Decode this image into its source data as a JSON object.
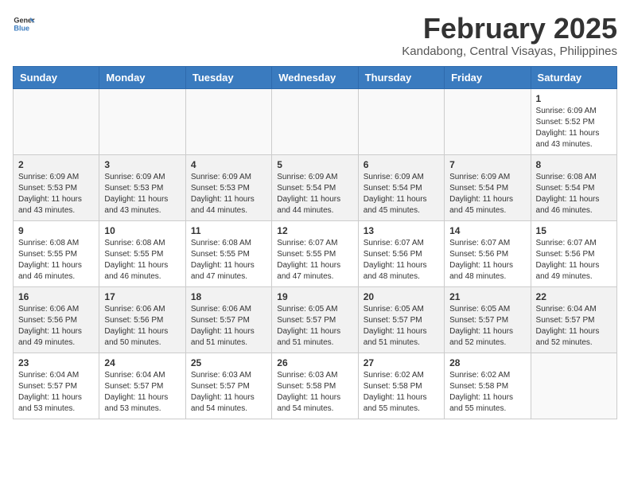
{
  "header": {
    "logo_general": "General",
    "logo_blue": "Blue",
    "month_year": "February 2025",
    "location": "Kandabong, Central Visayas, Philippines"
  },
  "days_of_week": [
    "Sunday",
    "Monday",
    "Tuesday",
    "Wednesday",
    "Thursday",
    "Friday",
    "Saturday"
  ],
  "weeks": [
    [
      {
        "day": "",
        "info": ""
      },
      {
        "day": "",
        "info": ""
      },
      {
        "day": "",
        "info": ""
      },
      {
        "day": "",
        "info": ""
      },
      {
        "day": "",
        "info": ""
      },
      {
        "day": "",
        "info": ""
      },
      {
        "day": "1",
        "info": "Sunrise: 6:09 AM\nSunset: 5:52 PM\nDaylight: 11 hours\nand 43 minutes."
      }
    ],
    [
      {
        "day": "2",
        "info": "Sunrise: 6:09 AM\nSunset: 5:53 PM\nDaylight: 11 hours\nand 43 minutes."
      },
      {
        "day": "3",
        "info": "Sunrise: 6:09 AM\nSunset: 5:53 PM\nDaylight: 11 hours\nand 43 minutes."
      },
      {
        "day": "4",
        "info": "Sunrise: 6:09 AM\nSunset: 5:53 PM\nDaylight: 11 hours\nand 44 minutes."
      },
      {
        "day": "5",
        "info": "Sunrise: 6:09 AM\nSunset: 5:54 PM\nDaylight: 11 hours\nand 44 minutes."
      },
      {
        "day": "6",
        "info": "Sunrise: 6:09 AM\nSunset: 5:54 PM\nDaylight: 11 hours\nand 45 minutes."
      },
      {
        "day": "7",
        "info": "Sunrise: 6:09 AM\nSunset: 5:54 PM\nDaylight: 11 hours\nand 45 minutes."
      },
      {
        "day": "8",
        "info": "Sunrise: 6:08 AM\nSunset: 5:54 PM\nDaylight: 11 hours\nand 46 minutes."
      }
    ],
    [
      {
        "day": "9",
        "info": "Sunrise: 6:08 AM\nSunset: 5:55 PM\nDaylight: 11 hours\nand 46 minutes."
      },
      {
        "day": "10",
        "info": "Sunrise: 6:08 AM\nSunset: 5:55 PM\nDaylight: 11 hours\nand 46 minutes."
      },
      {
        "day": "11",
        "info": "Sunrise: 6:08 AM\nSunset: 5:55 PM\nDaylight: 11 hours\nand 47 minutes."
      },
      {
        "day": "12",
        "info": "Sunrise: 6:07 AM\nSunset: 5:55 PM\nDaylight: 11 hours\nand 47 minutes."
      },
      {
        "day": "13",
        "info": "Sunrise: 6:07 AM\nSunset: 5:56 PM\nDaylight: 11 hours\nand 48 minutes."
      },
      {
        "day": "14",
        "info": "Sunrise: 6:07 AM\nSunset: 5:56 PM\nDaylight: 11 hours\nand 48 minutes."
      },
      {
        "day": "15",
        "info": "Sunrise: 6:07 AM\nSunset: 5:56 PM\nDaylight: 11 hours\nand 49 minutes."
      }
    ],
    [
      {
        "day": "16",
        "info": "Sunrise: 6:06 AM\nSunset: 5:56 PM\nDaylight: 11 hours\nand 49 minutes."
      },
      {
        "day": "17",
        "info": "Sunrise: 6:06 AM\nSunset: 5:56 PM\nDaylight: 11 hours\nand 50 minutes."
      },
      {
        "day": "18",
        "info": "Sunrise: 6:06 AM\nSunset: 5:57 PM\nDaylight: 11 hours\nand 51 minutes."
      },
      {
        "day": "19",
        "info": "Sunrise: 6:05 AM\nSunset: 5:57 PM\nDaylight: 11 hours\nand 51 minutes."
      },
      {
        "day": "20",
        "info": "Sunrise: 6:05 AM\nSunset: 5:57 PM\nDaylight: 11 hours\nand 51 minutes."
      },
      {
        "day": "21",
        "info": "Sunrise: 6:05 AM\nSunset: 5:57 PM\nDaylight: 11 hours\nand 52 minutes."
      },
      {
        "day": "22",
        "info": "Sunrise: 6:04 AM\nSunset: 5:57 PM\nDaylight: 11 hours\nand 52 minutes."
      }
    ],
    [
      {
        "day": "23",
        "info": "Sunrise: 6:04 AM\nSunset: 5:57 PM\nDaylight: 11 hours\nand 53 minutes."
      },
      {
        "day": "24",
        "info": "Sunrise: 6:04 AM\nSunset: 5:57 PM\nDaylight: 11 hours\nand 53 minutes."
      },
      {
        "day": "25",
        "info": "Sunrise: 6:03 AM\nSunset: 5:57 PM\nDaylight: 11 hours\nand 54 minutes."
      },
      {
        "day": "26",
        "info": "Sunrise: 6:03 AM\nSunset: 5:58 PM\nDaylight: 11 hours\nand 54 minutes."
      },
      {
        "day": "27",
        "info": "Sunrise: 6:02 AM\nSunset: 5:58 PM\nDaylight: 11 hours\nand 55 minutes."
      },
      {
        "day": "28",
        "info": "Sunrise: 6:02 AM\nSunset: 5:58 PM\nDaylight: 11 hours\nand 55 minutes."
      },
      {
        "day": "",
        "info": ""
      }
    ]
  ]
}
